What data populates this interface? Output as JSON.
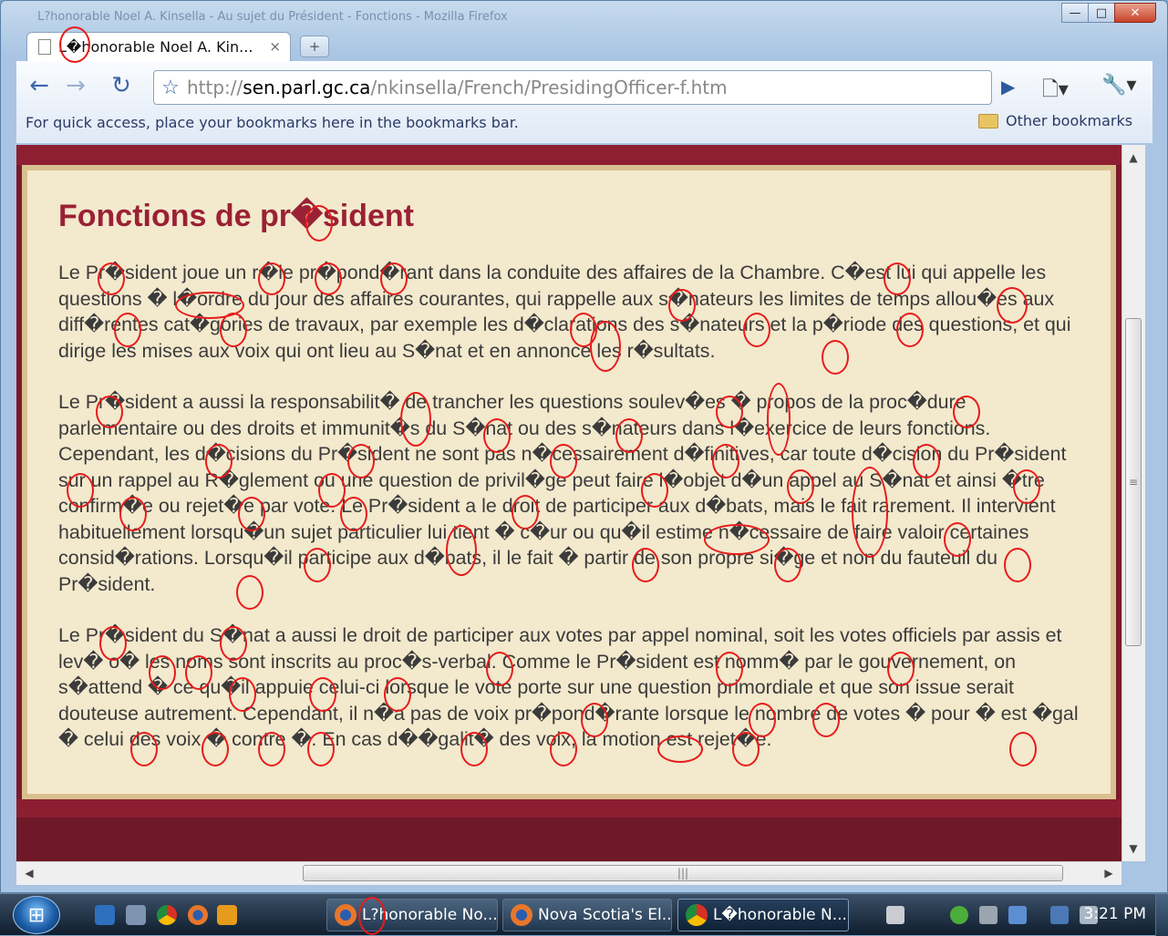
{
  "window": {
    "title_faint": "L?honorable Noel A. Kinsella - Au sujet du Président - Fonctions - Mozilla Firefox",
    "controls": {
      "minimize": "—",
      "maximize": "□",
      "close": "✕"
    }
  },
  "tab": {
    "title": "L�honorable Noel A. Kin...",
    "close": "×",
    "new_tab": "+"
  },
  "toolbar": {
    "back": "←",
    "forward": "→",
    "reload": "↻",
    "star": "☆",
    "url_scheme": "http://",
    "url_host": "sen.parl.gc.ca",
    "url_path": "/nkinsella/French/PresidingOfficer-f.htm",
    "go": "▶",
    "page_menu": "🗋▾",
    "wrench_menu": "🔧▾"
  },
  "bookmarks": {
    "hint": "For quick access, place your bookmarks here in the bookmarks bar.",
    "other": "Other bookmarks"
  },
  "page": {
    "heading": "Fonctions de pr�sident",
    "paragraphs": [
      "Le Pr�sident joue un r�le pr�pond�rant dans la conduite des affaires de la Chambre. C�est lui qui appelle les questions � l�ordre du jour des affaires courantes, qui rappelle aux s�nateurs les limites de temps allou�es aux diff�rentes cat�gories de travaux, par exemple les d�clarations des s�nateurs et la p�riode des questions, et qui dirige les mises aux voix qui ont lieu au S�nat et en annonce les r�sultats.",
      "Le Pr�sident a aussi la responsabilit� de trancher les questions soulev�es � propos de la proc�dure parlementaire ou des droits et immunit�s du S�nat ou des s�nateurs dans l�exercice de leurs fonctions. Cependant, les d�cisions du Pr�sident ne sont pas n�cessairement d�finitives, car toute d�cision du Pr�sident sur un rappel au R�glement ou une question de privil�ge peut faire l�objet d�un appel au S�nat et ainsi �tre confirm�e ou rejet�e par vote. Le Pr�sident a le droit de participer aux d�bats, mais le fait rarement. Il intervient habituellement lorsqu�un sujet particulier lui tient � c�ur ou qu�il estime n�cessaire de faire valoir certaines consid�rations. Lorsqu�il participe aux d�bats, il le fait � partir de son propre si�ge et non du fauteuil du Pr�sident.",
      "Le Pr�sident du S�nat a aussi le droit de participer aux votes par appel nominal, soit les votes officiels par assis et lev� o� les noms sont inscrits au proc�s-verbal. Comme le Pr�sident est nomm� par le gouvernement, on s�attend � ce qu�il appuie celui-ci lorsque le vote porte sur une question primordiale et que son issue serait douteuse autrement. Cependant, il n�a pas de voix pr�pond�rante lorsque le nombre de votes � pour � est �gal � celui des voix � contre �. En cas d��galit� des voix, la motion est rejet�e."
    ]
  },
  "scrollbars": {
    "up": "▲",
    "down": "▼",
    "left": "◀",
    "right": "▶",
    "grip_v": "≡",
    "grip_h": "|||"
  },
  "taskbar": {
    "start": "⊞",
    "buttons": [
      "L?honorable No...",
      "Nova Scotia's El...",
      "L�honorable N..."
    ],
    "clock": "3:21 PM"
  },
  "colors": {
    "heading": "#9a2135",
    "page_bg": "#7a1a2b",
    "panel": "#f3e9cd",
    "annotation": "#e81a1a"
  }
}
